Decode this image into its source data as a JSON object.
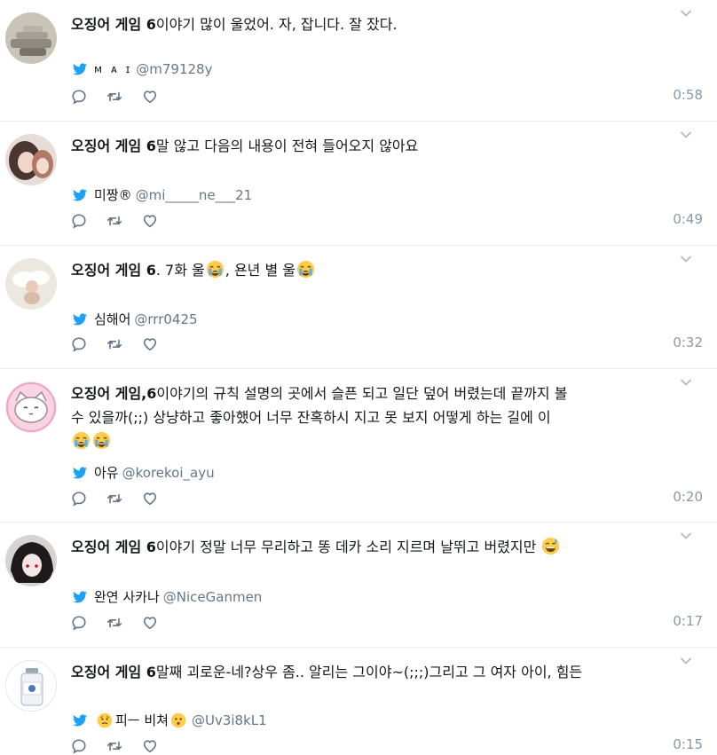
{
  "tweets": [
    {
      "hashtag": "오징어 게임 6",
      "body": "이야기 많이 울었어. 자, 잡니다. 잘 잤다.",
      "author_name": "ᴍ ᴀ ɪ",
      "handle": "@m79128y",
      "time": "0:58",
      "avatar": "rocks-avatar"
    },
    {
      "hashtag": "오징어 게임 6",
      "body": "말 않고 다음의 내용이 전혀 들어오지 않아요",
      "author_name": "미짱®",
      "handle": "@mi_____ne___21",
      "time": "0:49",
      "avatar": "girl-avatar"
    },
    {
      "hashtag": "오징어 게임 6",
      "body_before": ". 7화 울",
      "body_middle": ", 욘년 별 울",
      "author_name": "심해어",
      "handle": "@rrr0425",
      "time": "0:32",
      "avatar": "angel-avatar",
      "emojis": [
        "crying-face",
        "crying-face"
      ]
    },
    {
      "hashtag": "오징어 게임,6",
      "body_line1": "이야기의 규칙 설명의 곳에서 슬픈 되고 일단 덮어 버렸는데 끝까지 볼",
      "body_line2": "수 있을까(;;) 상냥하고 좋아했어 너무 잔혹하시 지고 못 보지 어떻게 하는 길에 이",
      "author_name": "아유",
      "handle": "@korekoi_ayu",
      "time": "0:20",
      "avatar": "cat-avatar",
      "emojis": [
        "crying-face",
        "crying-face"
      ]
    },
    {
      "hashtag": "오징어 게임 6",
      "body": "이야기 정말 너무 무리하고 똥 데카 소리 지르며 날뛰고 버렸지만",
      "author_name": "완연 사카나",
      "handle": "@NiceGanmen",
      "time": "0:17",
      "avatar": "dark-hair-avatar",
      "emojis": [
        "sweat-smile-face"
      ]
    },
    {
      "hashtag": "오징어 게임 6",
      "body": "말째 괴로운-네?상우 좀.. 알리는 그이야~(;;;)그리고 그 여자 아이, 힘든",
      "author_name": "피ㅡ 비쳐",
      "handle": "@Uv3i8kL1",
      "time": "0:15",
      "avatar": "bottle-avatar",
      "emojis": [
        "confused-face",
        "hushed-face"
      ]
    }
  ],
  "colors": {
    "twitter_blue": "#1da1f2",
    "meta_gray": "#657786",
    "time_gray": "#8899a6",
    "icon_gray": "#657786",
    "divider": "#e6ecf0",
    "emoji_yellow": "#ffcc4d"
  },
  "icons": [
    "twitter-bird-icon",
    "reply-icon",
    "retweet-icon",
    "like-icon",
    "chevron-down-icon"
  ]
}
